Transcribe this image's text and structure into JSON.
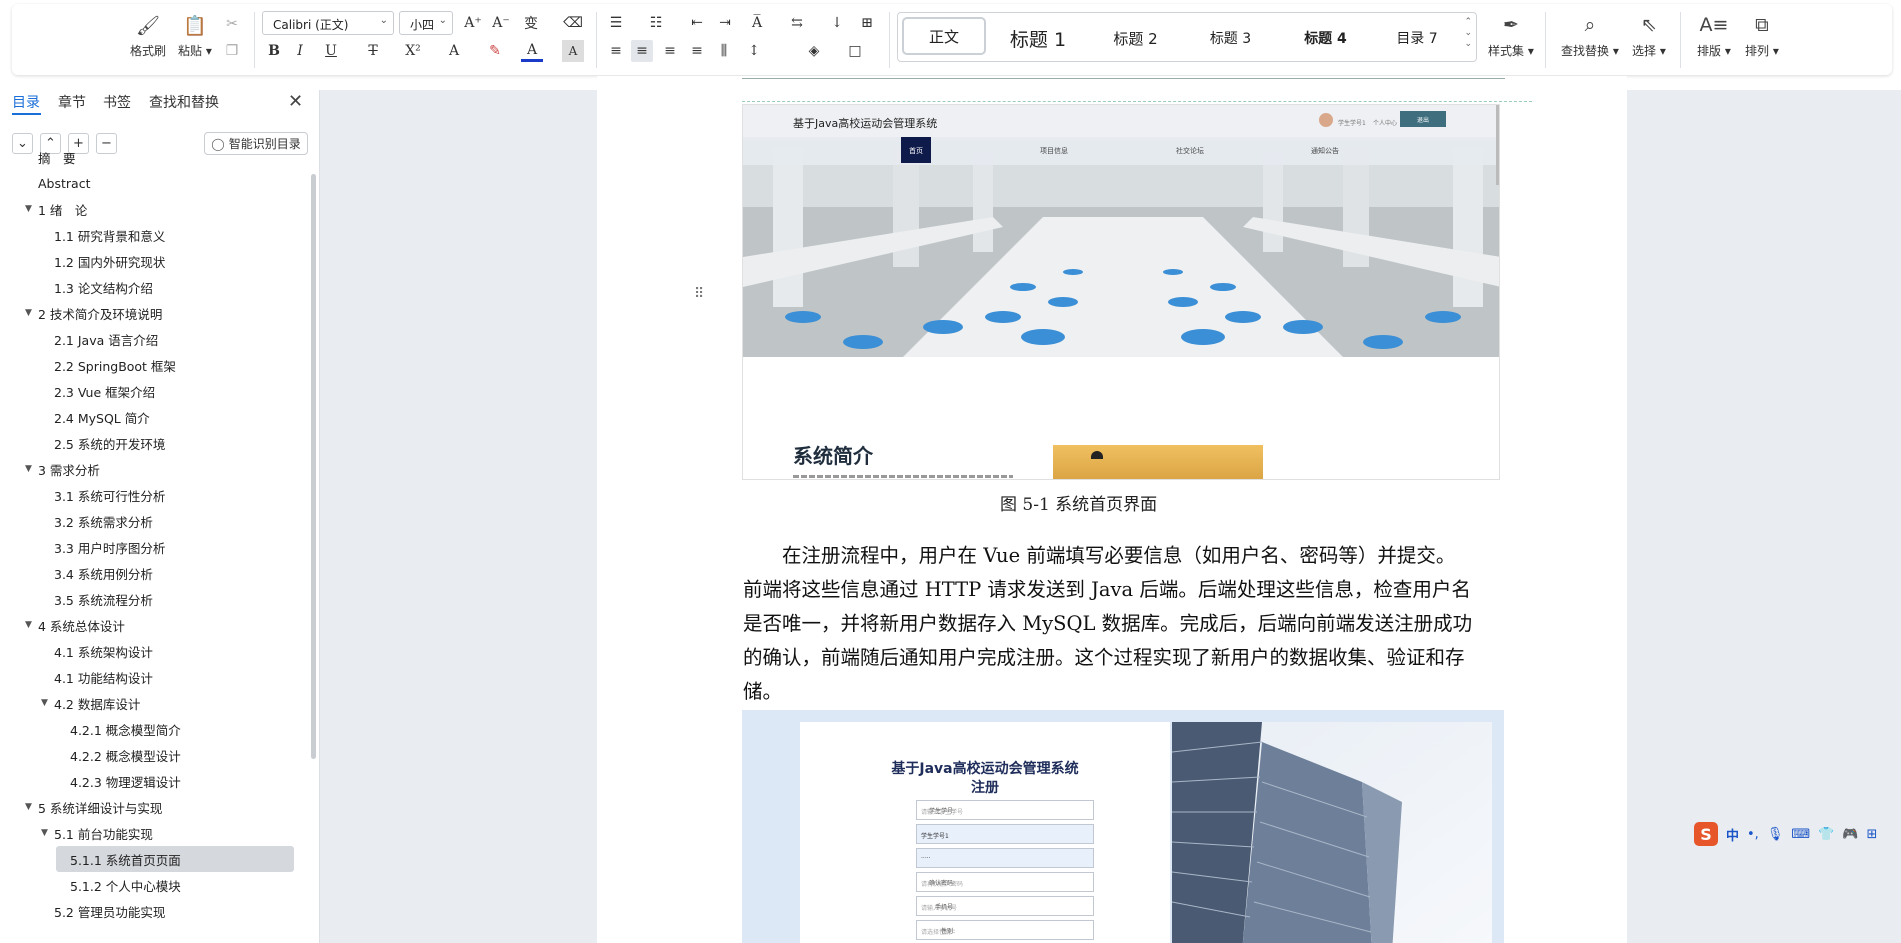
{
  "ribbon": {
    "format_painter": "格式刷",
    "paste": "粘贴",
    "font_name": "Calibri (正文)",
    "font_size": "小四",
    "styles": [
      {
        "label": "正文"
      },
      {
        "label": "标题 1"
      },
      {
        "label": "标题 2"
      },
      {
        "label": "标题 3"
      },
      {
        "label": "标题 4"
      },
      {
        "label": "目录 7"
      }
    ],
    "style_set": "样式集",
    "find_replace": "查找替换",
    "select": "选择",
    "typesetting": "排版",
    "arrange": "排列"
  },
  "sidebar": {
    "tabs": [
      "目录",
      "章节",
      "书签",
      "查找和替换"
    ],
    "smart_toc": "智能识别目录",
    "toc": [
      {
        "label": "摘　要",
        "level": 0,
        "toggle": false
      },
      {
        "label": "Abstract",
        "level": 0,
        "toggle": false
      },
      {
        "label": "1 绪　论",
        "level": 0,
        "toggle": true
      },
      {
        "label": "1.1 研究背景和意义",
        "level": 1,
        "toggle": false
      },
      {
        "label": "1.2 国内外研究现状",
        "level": 1,
        "toggle": false
      },
      {
        "label": "1.3 论文结构介绍",
        "level": 1,
        "toggle": false
      },
      {
        "label": "2 技术简介及环境说明",
        "level": 0,
        "toggle": true
      },
      {
        "label": "2.1 Java 语言介绍",
        "level": 1,
        "toggle": false
      },
      {
        "label": "2.2 SpringBoot 框架",
        "level": 1,
        "toggle": false
      },
      {
        "label": "2.3 Vue 框架介绍",
        "level": 1,
        "toggle": false
      },
      {
        "label": "2.4 MySQL 简介",
        "level": 1,
        "toggle": false
      },
      {
        "label": "2.5 系统的开发环境",
        "level": 1,
        "toggle": false
      },
      {
        "label": "3 需求分析",
        "level": 0,
        "toggle": true
      },
      {
        "label": "3.1 系统可行性分析",
        "level": 1,
        "toggle": false
      },
      {
        "label": "3.2 系统需求分析",
        "level": 1,
        "toggle": false
      },
      {
        "label": "3.3 用户时序图分析",
        "level": 1,
        "toggle": false
      },
      {
        "label": "3.4 系统用例分析",
        "level": 1,
        "toggle": false
      },
      {
        "label": "3.5 系统流程分析",
        "level": 1,
        "toggle": false
      },
      {
        "label": "4 系统总体设计",
        "level": 0,
        "toggle": true
      },
      {
        "label": "4.1 系统架构设计",
        "level": 1,
        "toggle": false
      },
      {
        "label": "4.1 功能结构设计",
        "level": 1,
        "toggle": false
      },
      {
        "label": "4.2 数据库设计",
        "level": 1,
        "toggle": true
      },
      {
        "label": "4.2.1 概念模型简介",
        "level": 2,
        "toggle": false
      },
      {
        "label": "4.2.2 概念模型设计",
        "level": 2,
        "toggle": false
      },
      {
        "label": "4.2.3 物理逻辑设计",
        "level": 2,
        "toggle": false
      },
      {
        "label": "5 系统详细设计与实现",
        "level": 0,
        "toggle": true
      },
      {
        "label": "5.1 前台功能实现",
        "level": 1,
        "toggle": true
      },
      {
        "label": "5.1.1 系统首页页面",
        "level": 2,
        "toggle": false,
        "selected": true
      },
      {
        "label": "5.1.2 个人中心模块",
        "level": 2,
        "toggle": false
      },
      {
        "label": "5.2 管理员功能实现",
        "level": 1,
        "toggle": false
      }
    ]
  },
  "document": {
    "screenshot1": {
      "site_title": "基于Java高校运动会管理系统",
      "user_text": "学生学号1",
      "center_text": "个人中心",
      "logout": "退出",
      "menu": [
        "首页",
        "项目信息",
        "社交论坛",
        "通知公告"
      ],
      "section_title": "系统简介"
    },
    "caption": "图 5-1  系统首页界面",
    "paragraph_lines": [
      "　　在注册流程中，用户在 Vue 前端填写必要信息（如用户名、密码等）并提交。",
      "前端将这些信息通过 HTTP 请求发送到 Java 后端。后端处理这些信息，检查用户名",
      "是否唯一，并将新用户数据存入 MySQL 数据库。完成后，后端向前端发送注册成功",
      "的确认，前端随后通知用户完成注册。这个过程实现了新用户的数据收集、验证和存",
      "储。"
    ],
    "screenshot2": {
      "title_line1": "基于Java高校运动会管理系统",
      "title_line2": "注册",
      "fields": [
        {
          "label": "学生学号:",
          "value": "请输入学生学号",
          "filled": false
        },
        {
          "label": "学生姓名:",
          "value": "学生学号1",
          "filled": true
        },
        {
          "label": "密码:",
          "value": "·····",
          "filled": true
        },
        {
          "label": "确认密码:",
          "value": "请再次输入密码",
          "filled": false
        },
        {
          "label": "手机号:",
          "value": "请输入手机号",
          "filled": false
        },
        {
          "label": "性别:",
          "value": "请选择性别",
          "filled": false
        }
      ]
    }
  },
  "ime": {
    "lang": "中"
  }
}
